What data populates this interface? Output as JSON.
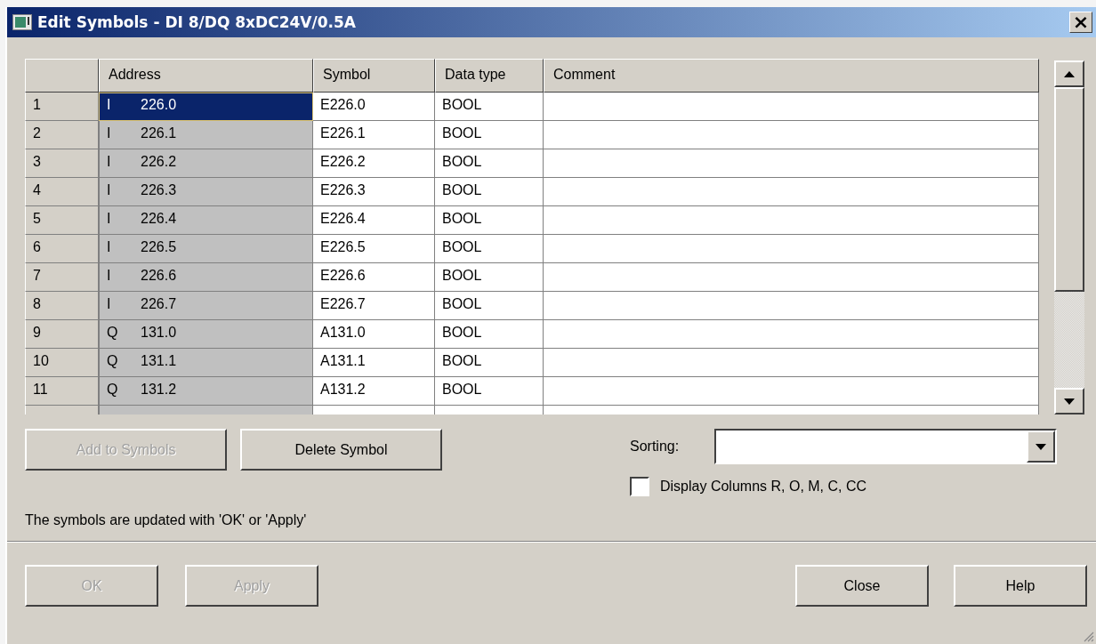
{
  "window": {
    "title": "Edit Symbols - DI 8/DQ 8xDC24V/0.5A",
    "close": "×"
  },
  "table": {
    "columns": [
      "Address",
      "Symbol",
      "Data type",
      "Comment"
    ],
    "rows": [
      {
        "number": "1",
        "area": "I",
        "address": "226.0",
        "symbol": "E226.0",
        "data_type": "BOOL",
        "selected": true
      },
      {
        "number": "2",
        "area": "I",
        "address": "226.1",
        "symbol": "E226.1",
        "data_type": "BOOL",
        "selected": false
      },
      {
        "number": "3",
        "area": "I",
        "address": "226.2",
        "symbol": "E226.2",
        "data_type": "BOOL",
        "selected": false
      },
      {
        "number": "4",
        "area": "I",
        "address": "226.3",
        "symbol": "E226.3",
        "data_type": "BOOL",
        "selected": false
      },
      {
        "number": "5",
        "area": "I",
        "address": "226.4",
        "symbol": "E226.4",
        "data_type": "BOOL",
        "selected": false
      },
      {
        "number": "6",
        "area": "I",
        "address": "226.5",
        "symbol": "E226.5",
        "data_type": "BOOL",
        "selected": false
      },
      {
        "number": "7",
        "area": "I",
        "address": "226.6",
        "symbol": "E226.6",
        "data_type": "BOOL",
        "selected": false
      },
      {
        "number": "8",
        "area": "I",
        "address": "226.7",
        "symbol": "E226.7",
        "data_type": "BOOL",
        "selected": false
      },
      {
        "number": "9",
        "area": "Q",
        "address": "131.0",
        "symbol": "A131.0",
        "data_type": "BOOL",
        "selected": false
      },
      {
        "number": "10",
        "area": "Q",
        "address": "131.1",
        "symbol": "A131.1",
        "data_type": "BOOL",
        "selected": false
      },
      {
        "number": "11",
        "area": "Q",
        "address": "131.2",
        "symbol": "A131.2",
        "data_type": "BOOL",
        "selected": false
      }
    ]
  },
  "symbol_buttons": [
    {
      "label": "Add to Symbols",
      "disabled": true
    },
    {
      "label": "Delete Symbol",
      "disabled": false
    }
  ],
  "sorting": {
    "label": "Sorting:"
  },
  "display_columns": {
    "label": "Display Columns R, O, M, C, CC",
    "checked": false
  },
  "message": "The symbols are updated with 'OK' or  'Apply'",
  "dialog_buttons_left": [
    {
      "label": "OK",
      "disabled": true
    },
    {
      "label": "Apply",
      "disabled": true
    }
  ],
  "dialog_buttons_right": [
    {
      "label": "Close",
      "disabled": false
    },
    {
      "label": "Help",
      "disabled": false
    }
  ]
}
